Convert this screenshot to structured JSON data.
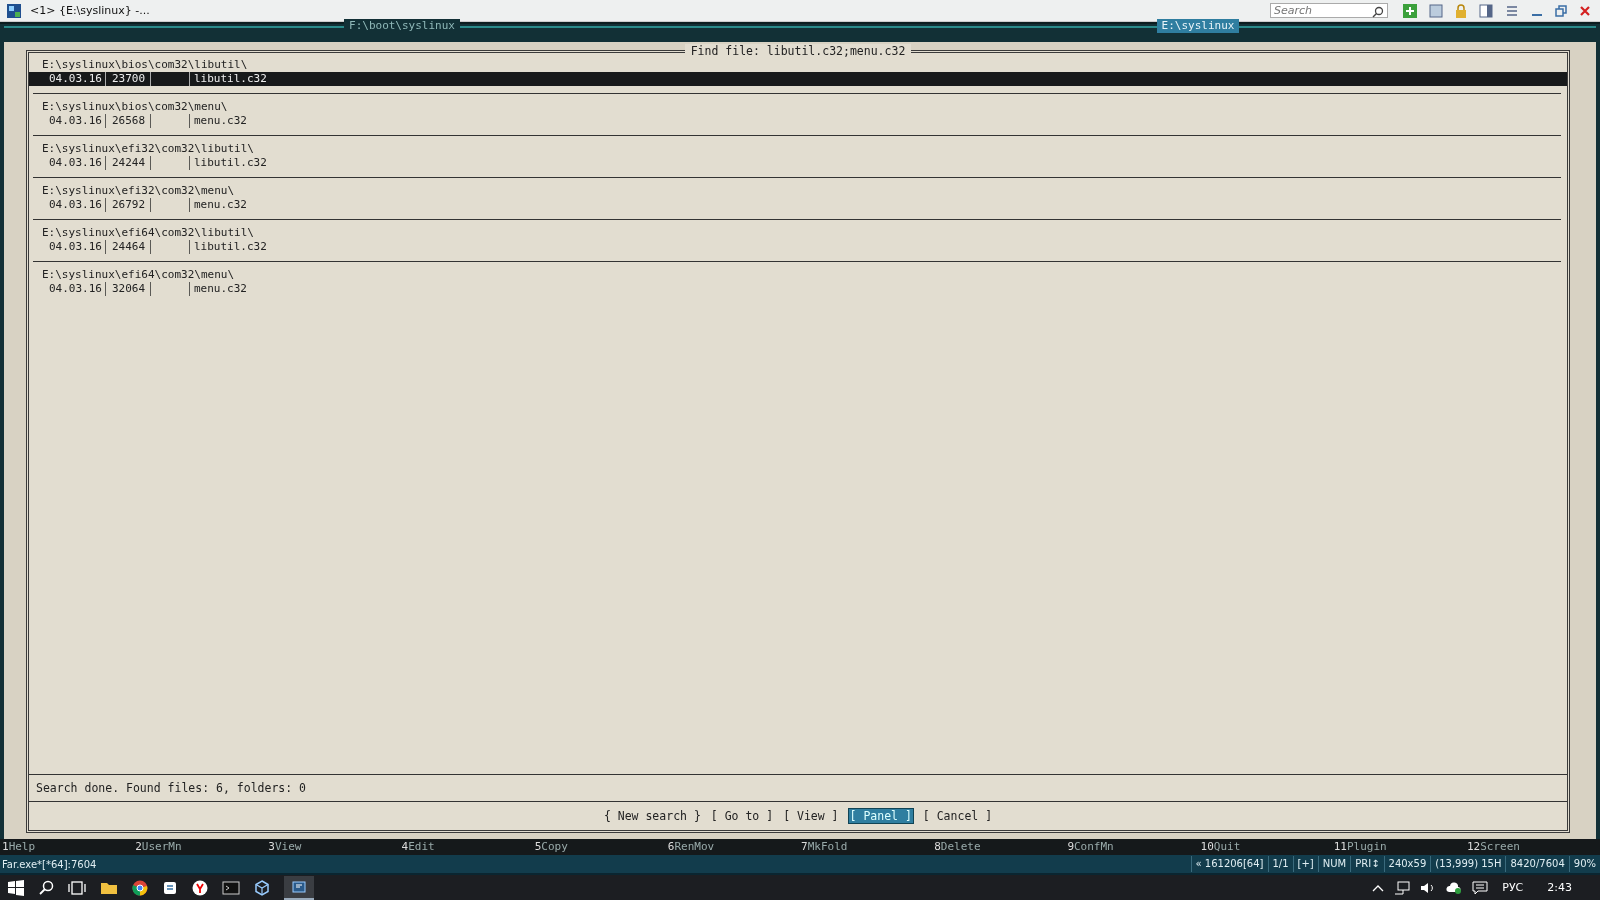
{
  "window": {
    "title": "<1> {E:\\syslinux} -...",
    "search": {
      "placeholder": "Search"
    }
  },
  "panels": [
    {
      "path": "F:\\boot\\syslinux",
      "active": false
    },
    {
      "path": "E:\\syslinux",
      "active": true
    }
  ],
  "dialog": {
    "title": "Find file: libutil.c32;menu.c32",
    "results": [
      {
        "folder": "E:\\syslinux\\bios\\com32\\libutil\\",
        "date": "04.03.16",
        "size": "23700",
        "name": "libutil.c32",
        "selected": true
      },
      {
        "folder": "E:\\syslinux\\bios\\com32\\menu\\",
        "date": "04.03.16",
        "size": "26568",
        "name": "menu.c32",
        "selected": false
      },
      {
        "folder": "E:\\syslinux\\efi32\\com32\\libutil\\",
        "date": "04.03.16",
        "size": "24244",
        "name": "libutil.c32",
        "selected": false
      },
      {
        "folder": "E:\\syslinux\\efi32\\com32\\menu\\",
        "date": "04.03.16",
        "size": "26792",
        "name": "menu.c32",
        "selected": false
      },
      {
        "folder": "E:\\syslinux\\efi64\\com32\\libutil\\",
        "date": "04.03.16",
        "size": "24464",
        "name": "libutil.c32",
        "selected": false
      },
      {
        "folder": "E:\\syslinux\\efi64\\com32\\menu\\",
        "date": "04.03.16",
        "size": "32064",
        "name": "menu.c32",
        "selected": false
      }
    ],
    "status": "Search done. Found files: 6, folders: 0",
    "buttons": [
      {
        "label": "{ New search }",
        "selected": false
      },
      {
        "label": "[ Go to ]",
        "selected": false
      },
      {
        "label": "[ View ]",
        "selected": false
      },
      {
        "label": "[ Panel ]",
        "selected": true
      },
      {
        "label": "[ Cancel ]",
        "selected": false
      }
    ]
  },
  "keybar": [
    {
      "key": "1",
      "label": "Help"
    },
    {
      "key": "2",
      "label": "UserMn"
    },
    {
      "key": "3",
      "label": "View"
    },
    {
      "key": "4",
      "label": "Edit"
    },
    {
      "key": "5",
      "label": "Copy"
    },
    {
      "key": "6",
      "label": "RenMov"
    },
    {
      "key": "7",
      "label": "MkFold"
    },
    {
      "key": "8",
      "label": "Delete"
    },
    {
      "key": "9",
      "label": "ConfMn"
    },
    {
      "key": "10",
      "label": "Quit"
    },
    {
      "key": "11",
      "label": "Plugin"
    },
    {
      "key": "12",
      "label": "Screen"
    }
  ],
  "status_bar": {
    "process": "Far.exe*[*64]:7604",
    "fields": [
      "« 161206[64]",
      "1/1",
      "[+]",
      "NUM",
      "PRI↕",
      "240x59",
      "(13,999) 15H",
      "8420/7604",
      "90%"
    ]
  },
  "taskbar": {
    "language": "РУС",
    "time": "2:43"
  }
}
